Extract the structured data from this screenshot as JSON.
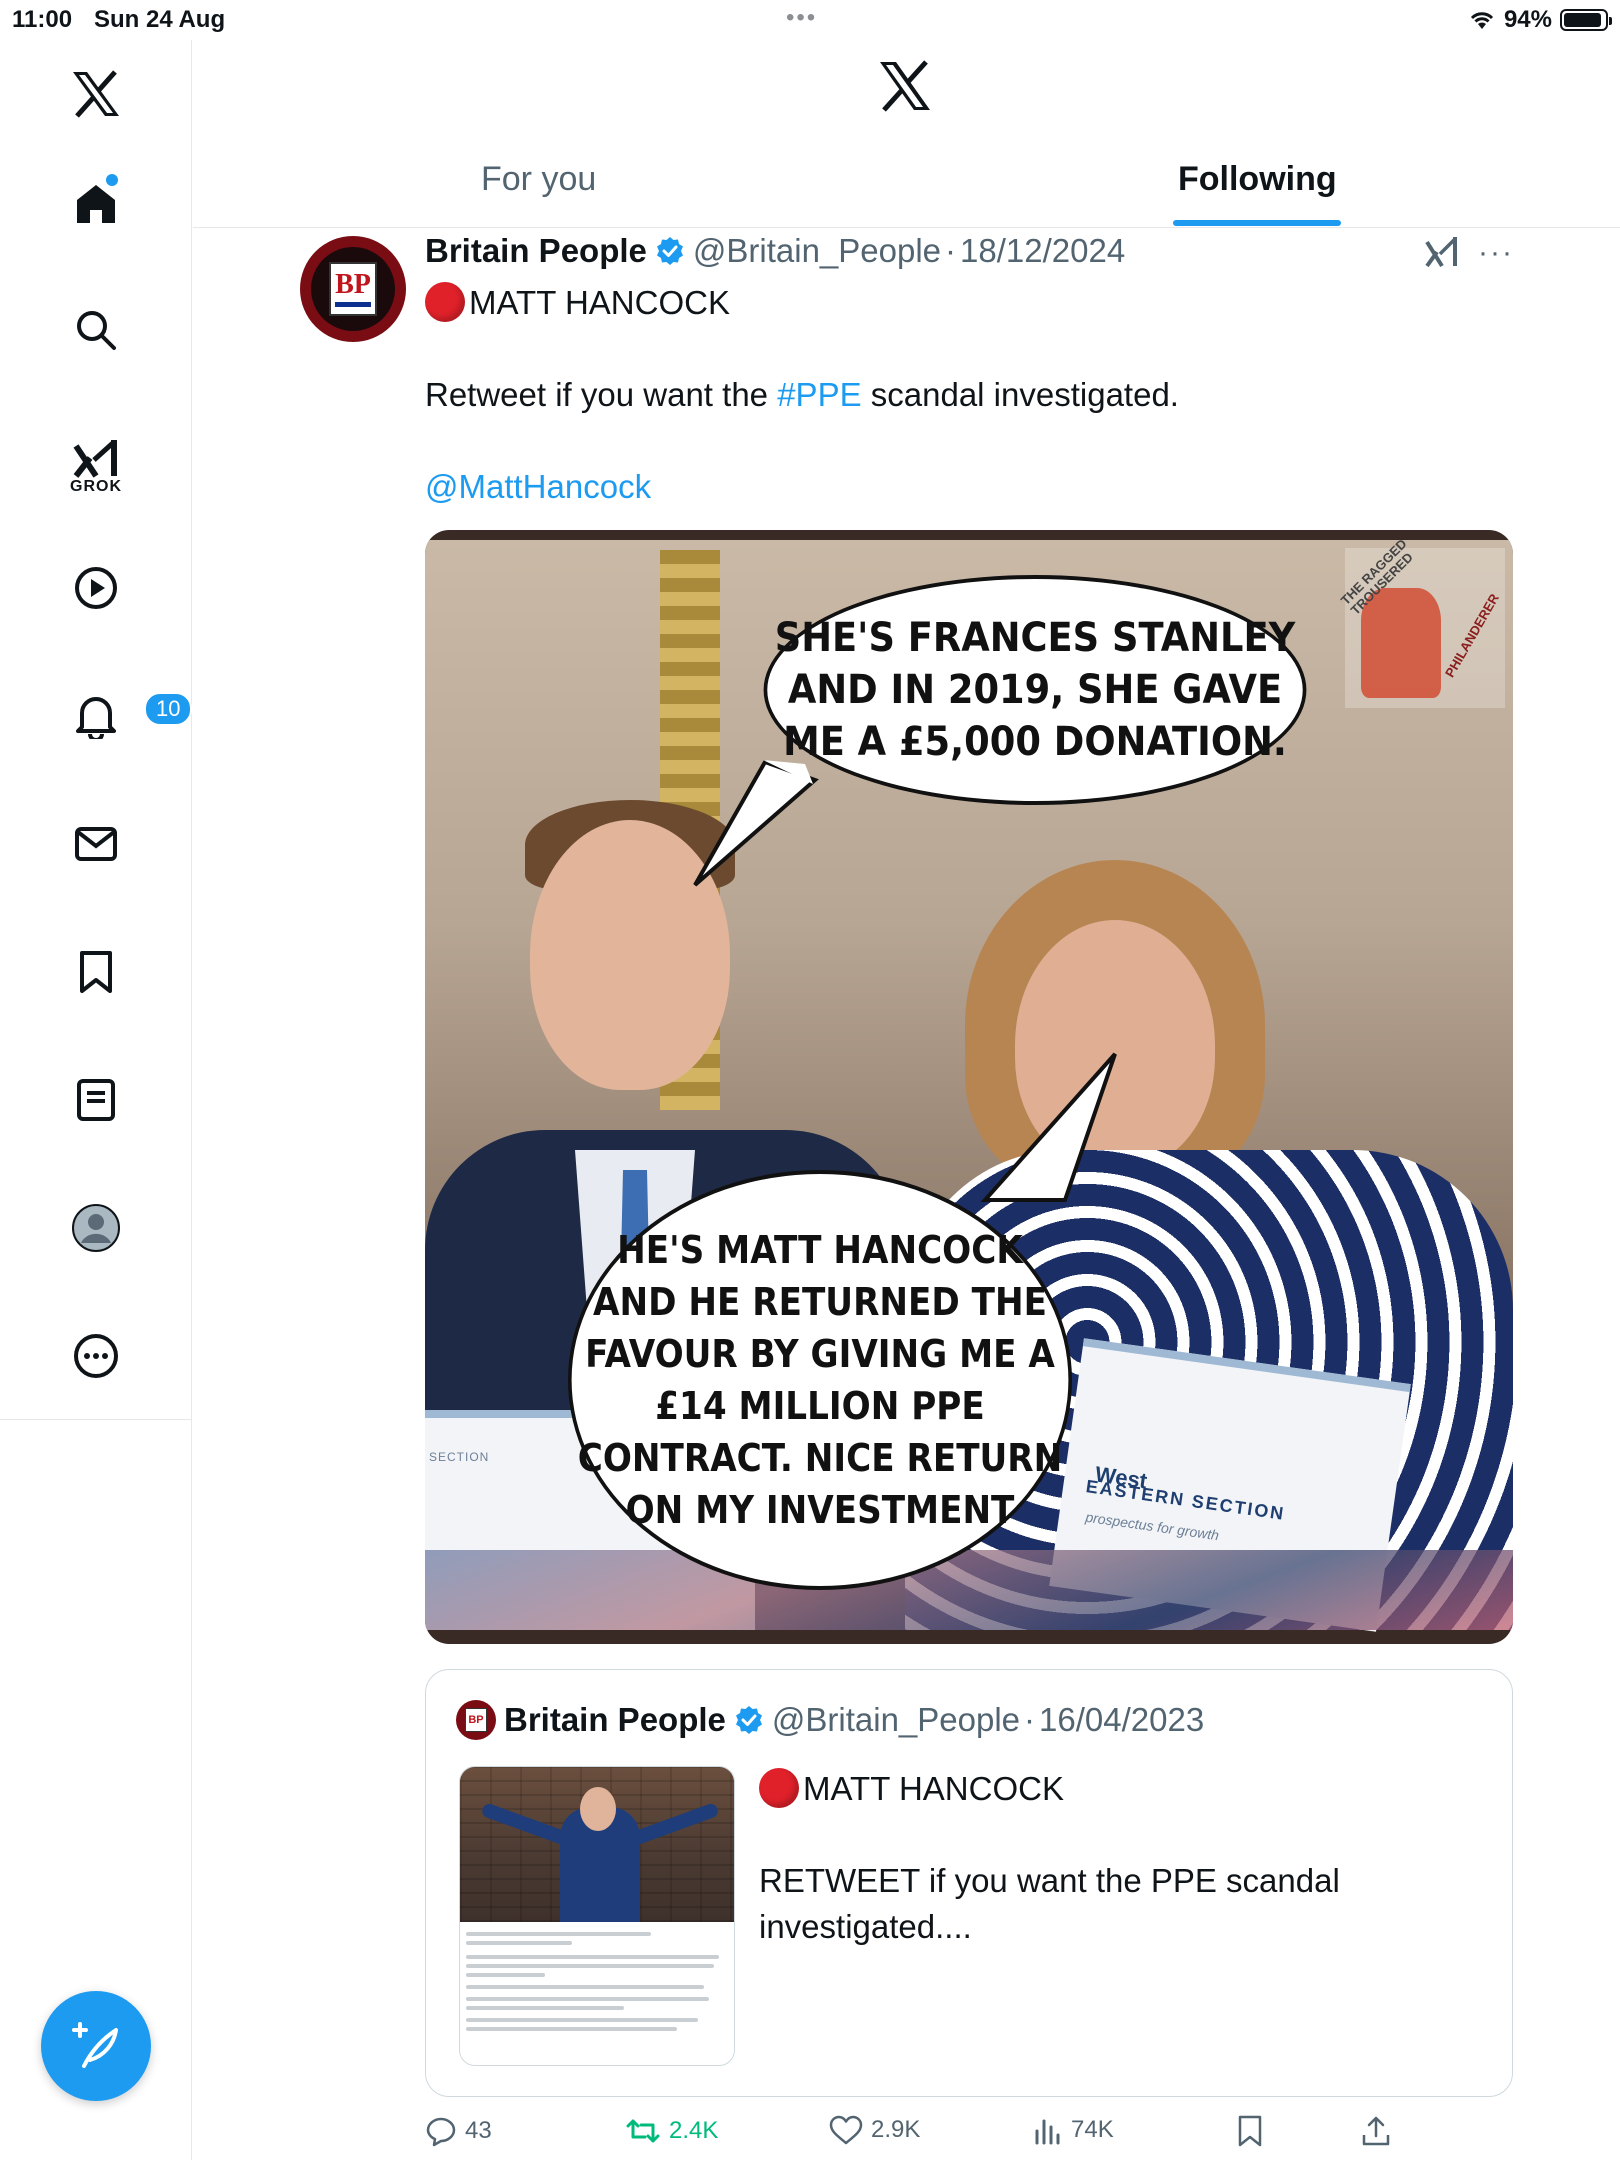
{
  "status_bar": {
    "time": "11:00",
    "date": "Sun 24 Aug",
    "battery": "94%"
  },
  "nav": {
    "notifications_badge": "10",
    "grok_label": "GROK"
  },
  "header": {
    "tabs": [
      {
        "label": "For you",
        "active": false
      },
      {
        "label": "Following",
        "active": true
      }
    ]
  },
  "tweet": {
    "author_name": "Britain People",
    "handle": "@Britain_People",
    "separator": "·",
    "date": "18/12/2024",
    "line1": "MATT HANCOCK",
    "line2_pre": "Retweet if you want the ",
    "hashtag": "#PPE",
    "line2_post": " scandal investigated.",
    "mention": "@MattHancock",
    "avatar_text": "BP",
    "image": {
      "bubble1": "SHE'S FRANCES STANLEY AND IN 2019, SHE GAVE ME A £5,000 DONATION.",
      "bubble2": "HE'S MATT HANCOCK AND HE RETURNED THE FAVOUR BY GIVING ME A £14 MILLION PPE CONTRACT. NICE RETURN ON MY INVESTMENT",
      "watermark_top": "THE RAGGED TROUSERED",
      "watermark_bottom": "PHILANDERER",
      "box_brand": "West",
      "box_title": "EASTERN SECTION",
      "box_sub": "prospectus for growth",
      "box_left": "SECTION"
    }
  },
  "quote": {
    "author_name": "Britain People",
    "handle": "@Britain_People",
    "separator": "·",
    "date": "16/04/2023",
    "line1": "MATT HANCOCK",
    "line2": "RETWEET if you want the PPE scandal investigated...."
  },
  "actions": {
    "replies": "43",
    "reposts": "2.4K",
    "likes": "2.9K",
    "views": "74K"
  },
  "colors": {
    "accent": "#1d9bf0",
    "repost_green": "#00ba7c",
    "text_secondary": "#536471"
  }
}
